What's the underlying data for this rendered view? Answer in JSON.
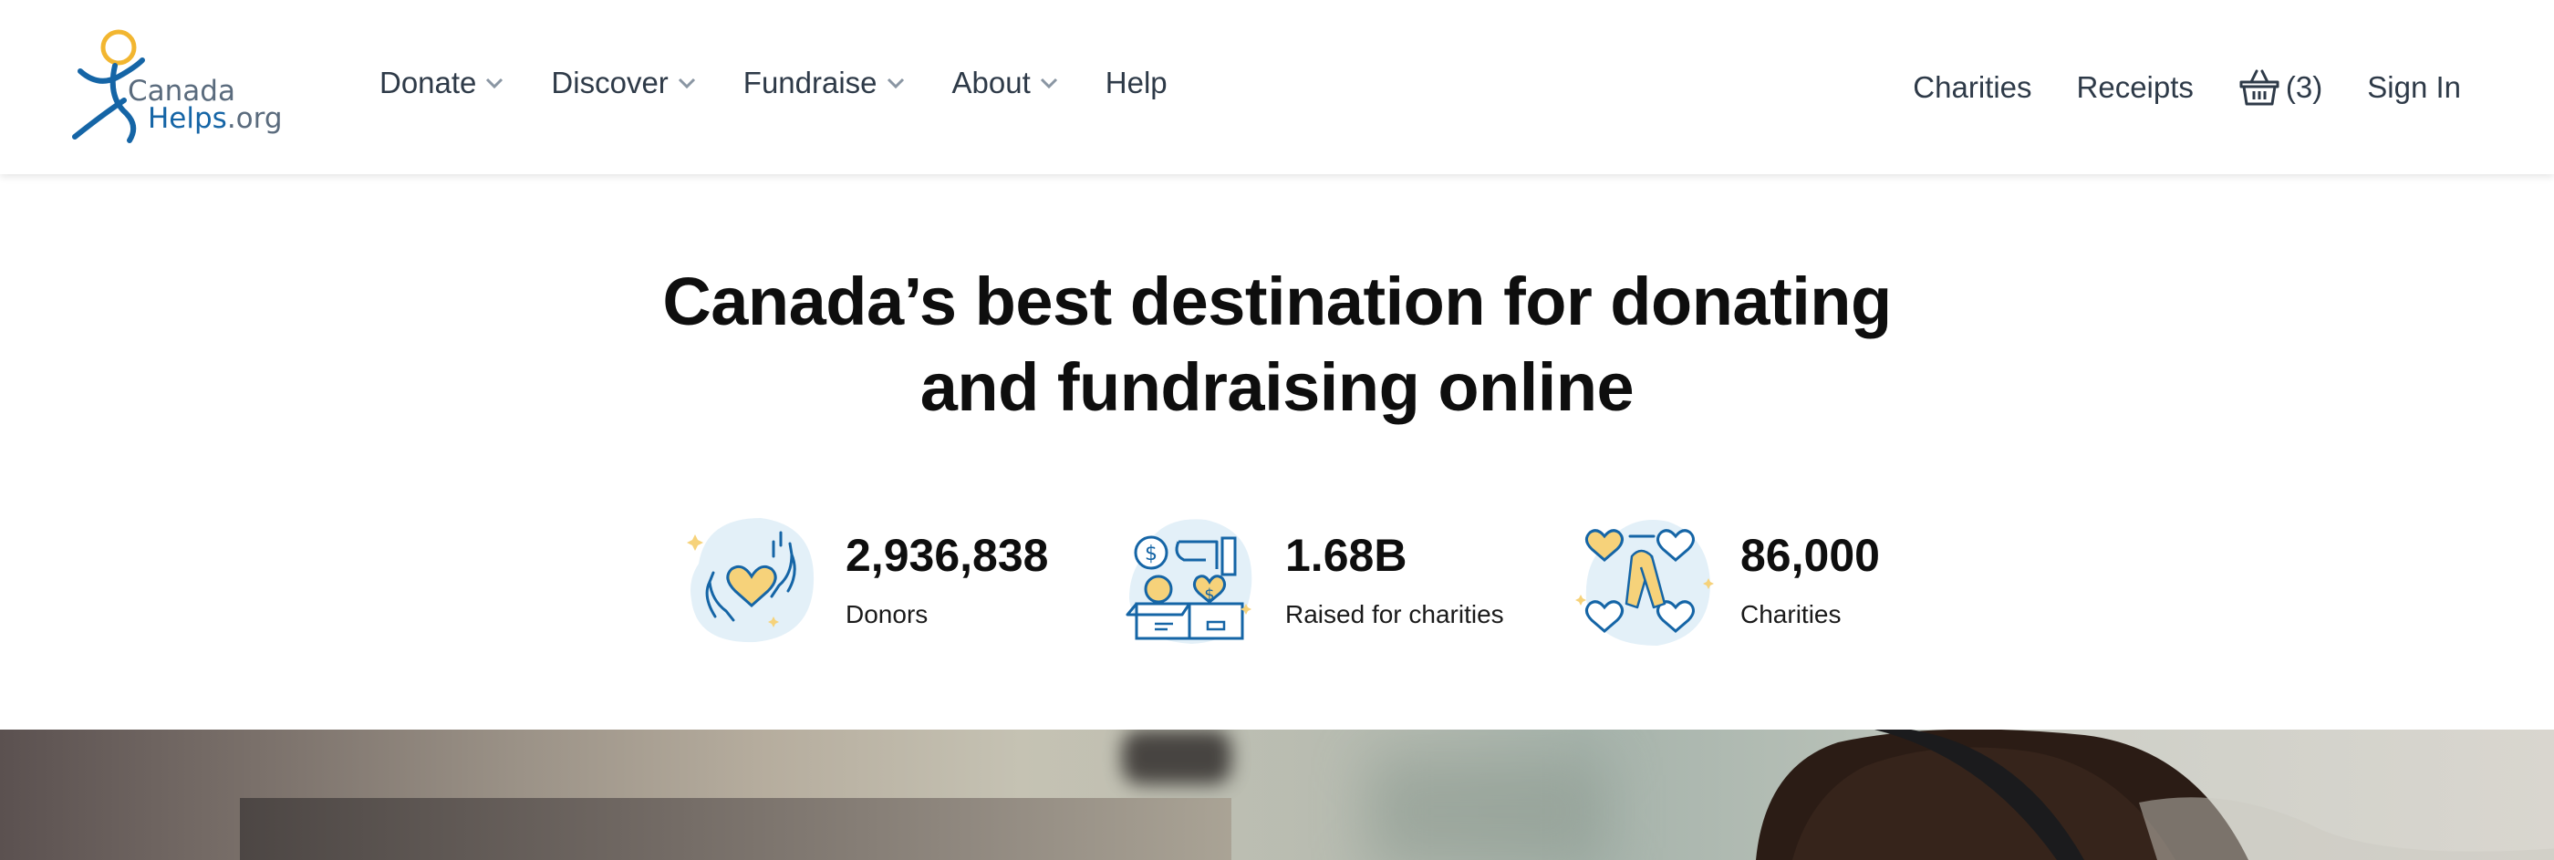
{
  "logo": {
    "line1": "Canada",
    "line2_main": "Helps",
    "line2_suffix": ".org"
  },
  "nav": {
    "items": [
      {
        "label": "Donate",
        "has_dropdown": true
      },
      {
        "label": "Discover",
        "has_dropdown": true
      },
      {
        "label": "Fundraise",
        "has_dropdown": true
      },
      {
        "label": "About",
        "has_dropdown": true
      },
      {
        "label": "Help",
        "has_dropdown": false
      }
    ],
    "right": {
      "charities": "Charities",
      "receipts": "Receipts",
      "basket_count": "(3)",
      "sign_in": "Sign In"
    }
  },
  "hero": {
    "title_line1": "Canada’s best destination for donating",
    "title_line2": "and fundraising online"
  },
  "stats": [
    {
      "icon": "hands-heart-icon",
      "number": "2,936,838",
      "label": "Donors"
    },
    {
      "icon": "donation-box-icon",
      "number": "1.68B",
      "label": "Raised for charities"
    },
    {
      "icon": "ribbon-hearts-icon",
      "number": "86,000",
      "label": "Charities"
    }
  ],
  "colors": {
    "brand_blue": "#1565a6",
    "brand_yellow": "#f2b630",
    "text_dark": "#2e3a48",
    "icon_yellow_fill": "#f6d27a",
    "icon_bg": "#e3f0f8"
  }
}
